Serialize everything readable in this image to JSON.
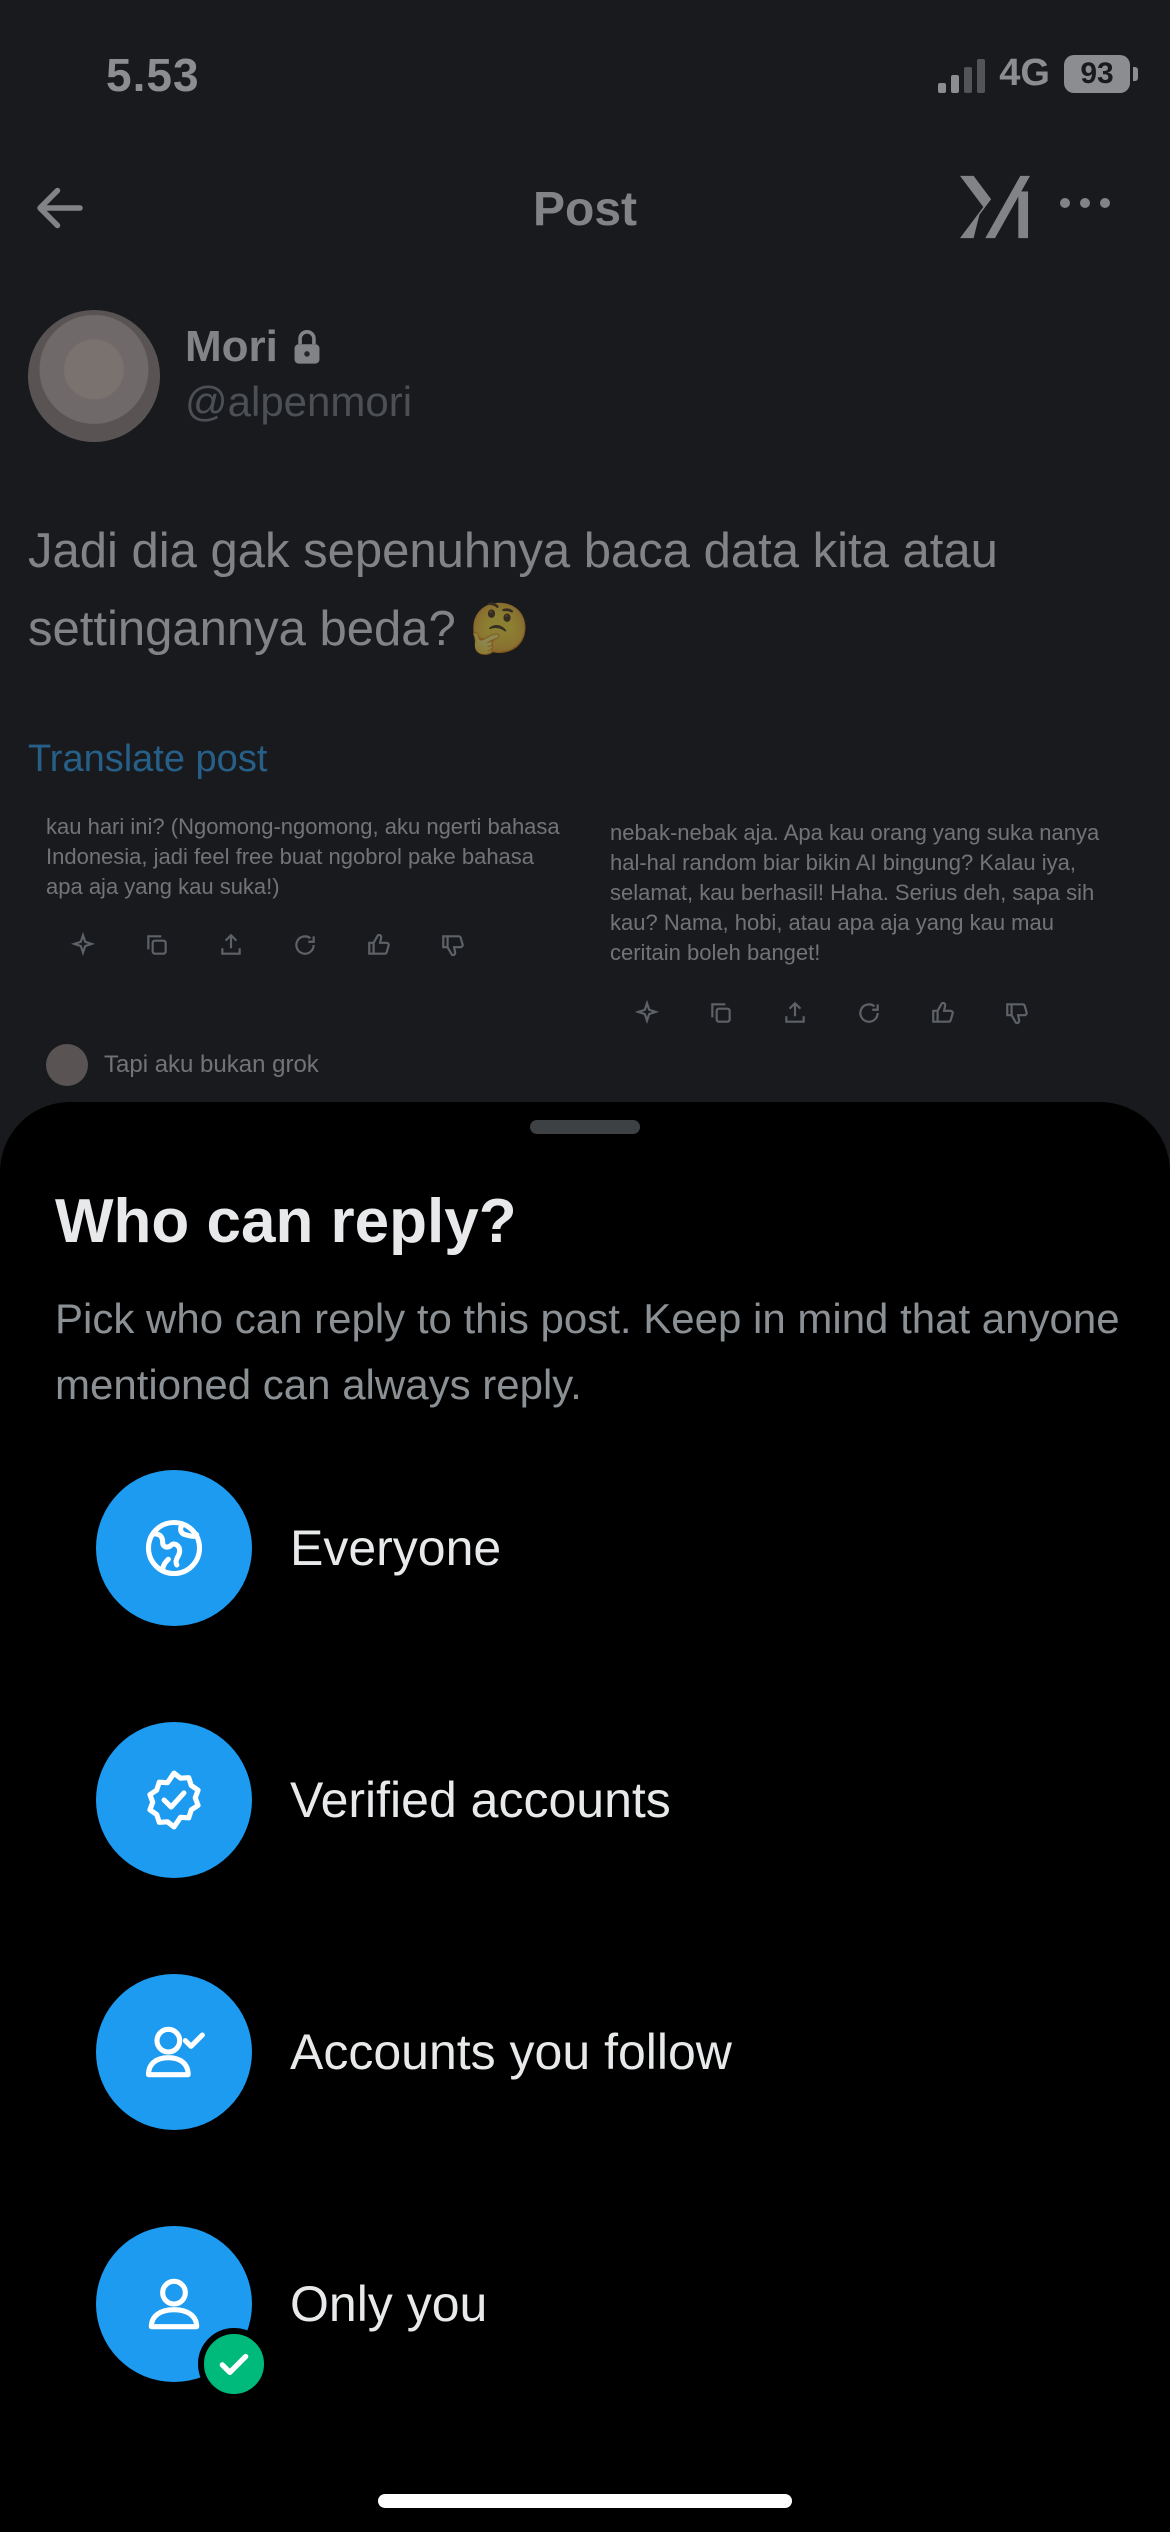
{
  "status_bar": {
    "time": "5.53",
    "network": "4G",
    "battery": "93"
  },
  "header": {
    "title": "Post"
  },
  "post": {
    "author_name": "Mori",
    "author_handle": "@alpenmori",
    "text": "Jadi dia gak sepenuhnya baca data kita atau settingannya beda? 🤔",
    "translate_label": "Translate post"
  },
  "embedded": {
    "left_text": "kau hari ini? (Ngomong-ngomong, aku ngerti bahasa Indonesia, jadi feel free buat ngobrol pake bahasa apa aja yang kau suka!)",
    "right_text": "nebak-nebak aja. Apa kau orang yang suka nanya hal-hal random biar bikin AI bingung? Kalau iya, selamat, kau berhasil! Haha. Serius deh, sapa sih kau? Nama, hobi, atau apa aja yang kau mau ceritain boleh banget!",
    "user_line": "Tapi aku bukan grok"
  },
  "sheet": {
    "title": "Who can reply?",
    "description": "Pick who can reply to this post. Keep in mind that anyone mentioned can always reply.",
    "options": [
      {
        "label": "Everyone",
        "icon": "globe-icon",
        "selected": false
      },
      {
        "label": "Verified accounts",
        "icon": "verified-badge-icon",
        "selected": false
      },
      {
        "label": "Accounts you follow",
        "icon": "person-check-icon",
        "selected": false
      },
      {
        "label": "Only you",
        "icon": "person-icon",
        "selected": true
      }
    ]
  },
  "colors": {
    "accent": "#1d9bf0",
    "selected": "#00ba7c",
    "sheet_bg": "#000000"
  }
}
